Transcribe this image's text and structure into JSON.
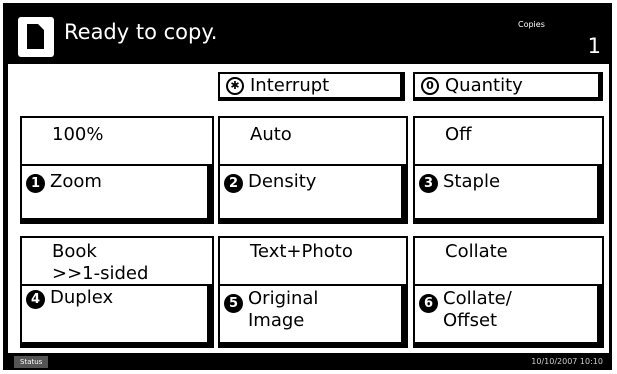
{
  "header": {
    "message": "Ready to copy.",
    "copies_label": "Copies",
    "copies_value": "1"
  },
  "top_buttons": {
    "interrupt": {
      "glyph": "✱",
      "label": "Interrupt"
    },
    "quantity": {
      "glyph": "0",
      "label": "Quantity"
    }
  },
  "tiles": [
    {
      "value": "100%",
      "number": "1",
      "label": "Zoom"
    },
    {
      "value": "Auto",
      "number": "2",
      "label": "Density"
    },
    {
      "value": "Off",
      "number": "3",
      "label": "Staple"
    },
    {
      "value_line1": "Book",
      "value_line2": ">>1-sided",
      "number": "4",
      "label": "Duplex"
    },
    {
      "value": "Text+Photo",
      "number": "5",
      "label_line1": "Original",
      "label_line2": "Image"
    },
    {
      "value": "Collate",
      "number": "6",
      "label_line1": "Collate/",
      "label_line2": "Offset"
    }
  ],
  "status_bar": {
    "status_label": "Status",
    "datetime": "10/10/2007  10:10"
  },
  "icons": {
    "document": "copy-document-icon",
    "interrupt": "asterisk-circle-icon",
    "quantity": "zero-circle-icon"
  },
  "colors": {
    "background": "#000000",
    "panel": "#ffffff",
    "text": "#000000"
  }
}
